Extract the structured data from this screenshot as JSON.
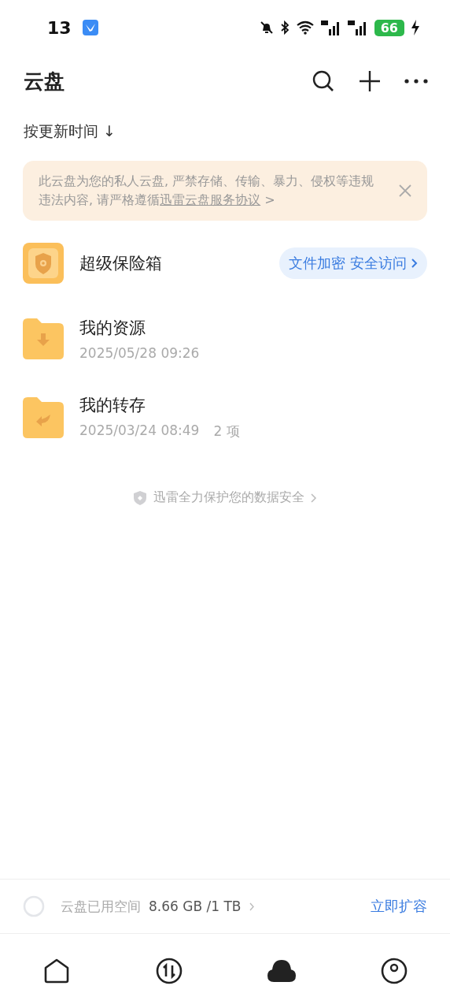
{
  "status_bar": {
    "time": "13",
    "battery": "66"
  },
  "header": {
    "title": "云盘"
  },
  "sort": {
    "label": "按更新时间 ↓"
  },
  "notice": {
    "text": "此云盘为您的私人云盘, 严禁存储、传输、暴力、侵权等违规违法内容, 请严格遵循",
    "link": "迅雷云盘服务协议",
    "after": " >"
  },
  "vault": {
    "name": "超级保险箱",
    "action": "文件加密 安全访问"
  },
  "folders": [
    {
      "name": "我的资源",
      "kind": "download",
      "date": "2025/05/28 09:26"
    },
    {
      "name": "我的转存",
      "kind": "transfer",
      "date": "2025/03/24 08:49",
      "count": "2 项"
    }
  ],
  "security_note": "迅雷全力保护您的数据安全",
  "storage": {
    "label": "云盘已用空间",
    "used": "8.66 GB /1 TB",
    "action": "立即扩容"
  },
  "nav": [
    {
      "kind": "home",
      "selected": false
    },
    {
      "kind": "transfer",
      "selected": false
    },
    {
      "kind": "cloud",
      "selected": true
    },
    {
      "kind": "profile",
      "selected": false
    }
  ]
}
